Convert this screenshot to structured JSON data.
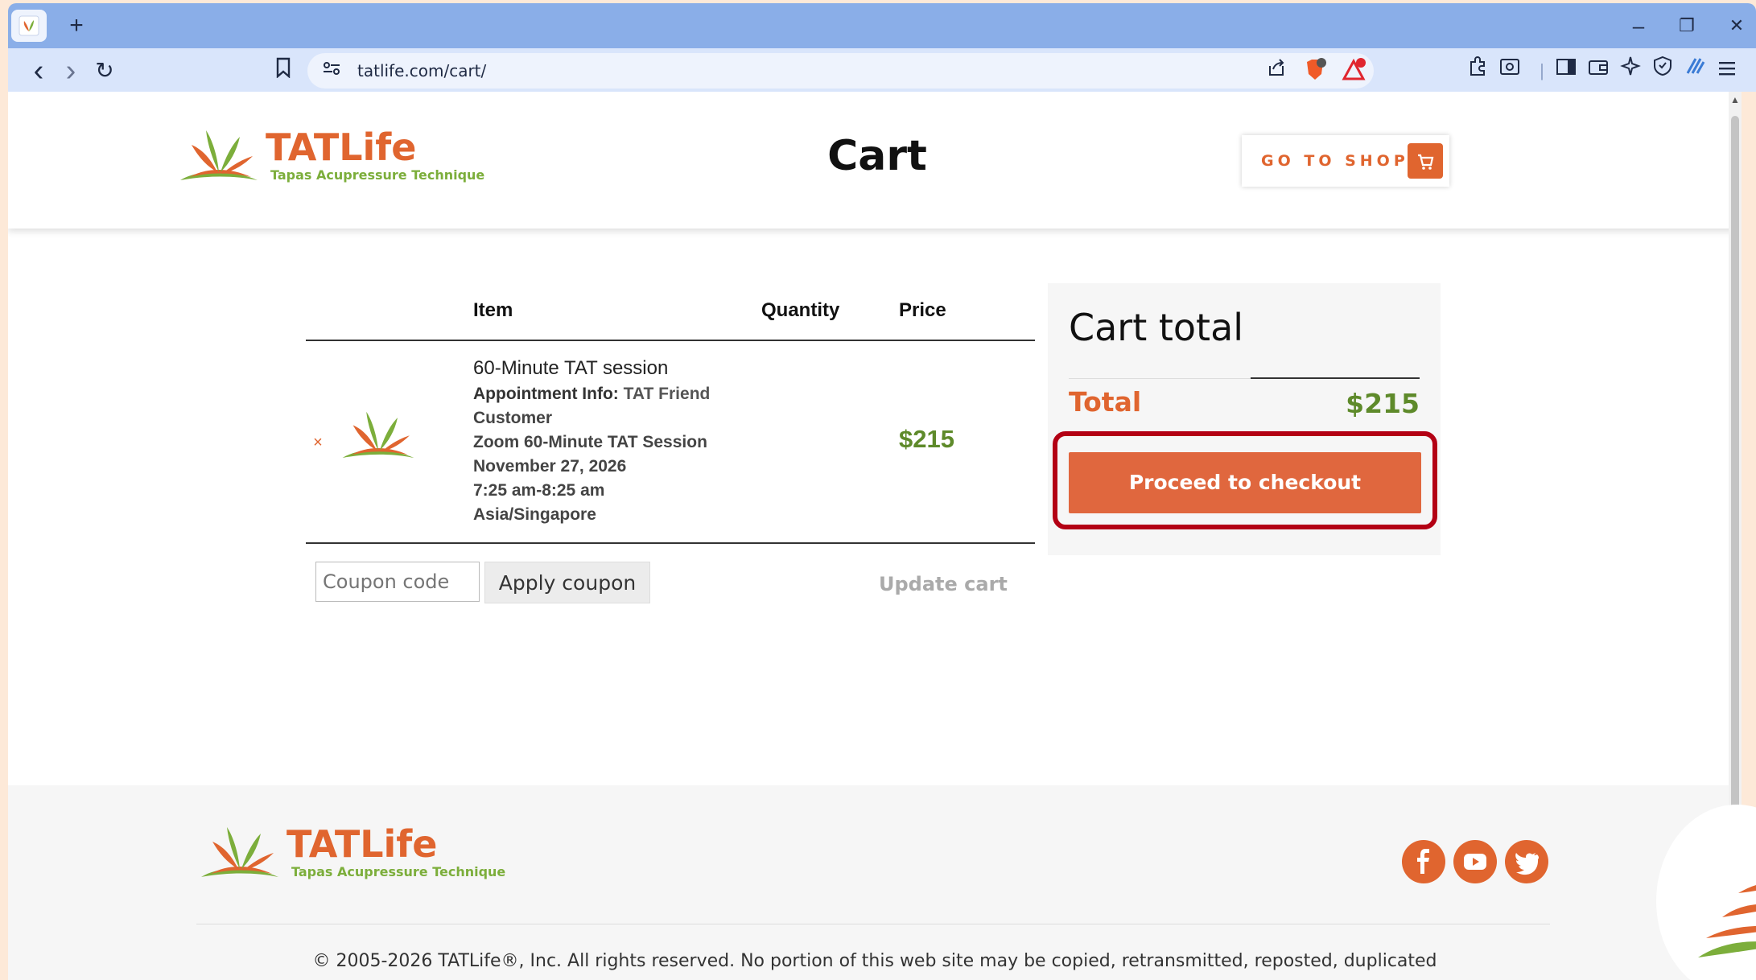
{
  "browser": {
    "url": "tatlife.com/cart/",
    "new_tab": "+",
    "minimize": "–",
    "restore": "❐",
    "close": "✕",
    "back": "‹",
    "forward": "›",
    "reload": "↻"
  },
  "header": {
    "logo_name": "TATLife",
    "logo_tag": "Tapas Acupressure Technique",
    "title": "Cart",
    "shop_button": "GO TO SHOP"
  },
  "cart": {
    "columns": [
      "Item",
      "Quantity",
      "Price"
    ],
    "remove": "×",
    "item": {
      "name": "60-Minute TAT session",
      "appointment_label": "Appointment Info:",
      "appointment_value": "TAT Friend",
      "lines": [
        "Customer",
        "Zoom 60-Minute TAT Session",
        "November 27, 2026",
        "7:25 am-8:25 am",
        "Asia/Singapore"
      ],
      "price": "$215"
    },
    "coupon_placeholder": "Coupon code",
    "apply_coupon": "Apply coupon",
    "update_cart": "Update cart"
  },
  "totals": {
    "title": "Cart total",
    "total_label": "Total",
    "total_value": "$215",
    "checkout": "Proceed to checkout"
  },
  "footer": {
    "logo_name": "TATLife",
    "logo_tag": "Tapas Acupressure Technique",
    "copyright": "© 2005-2026 TATLife®, Inc. All rights reserved. No portion of this web site may be copied, retransmitted, reposted, duplicated"
  },
  "colors": {
    "brand_orange": "#e0652f",
    "brand_green": "#7cae3b",
    "price_green": "#5e8a2a",
    "highlight_red": "#b30014"
  }
}
